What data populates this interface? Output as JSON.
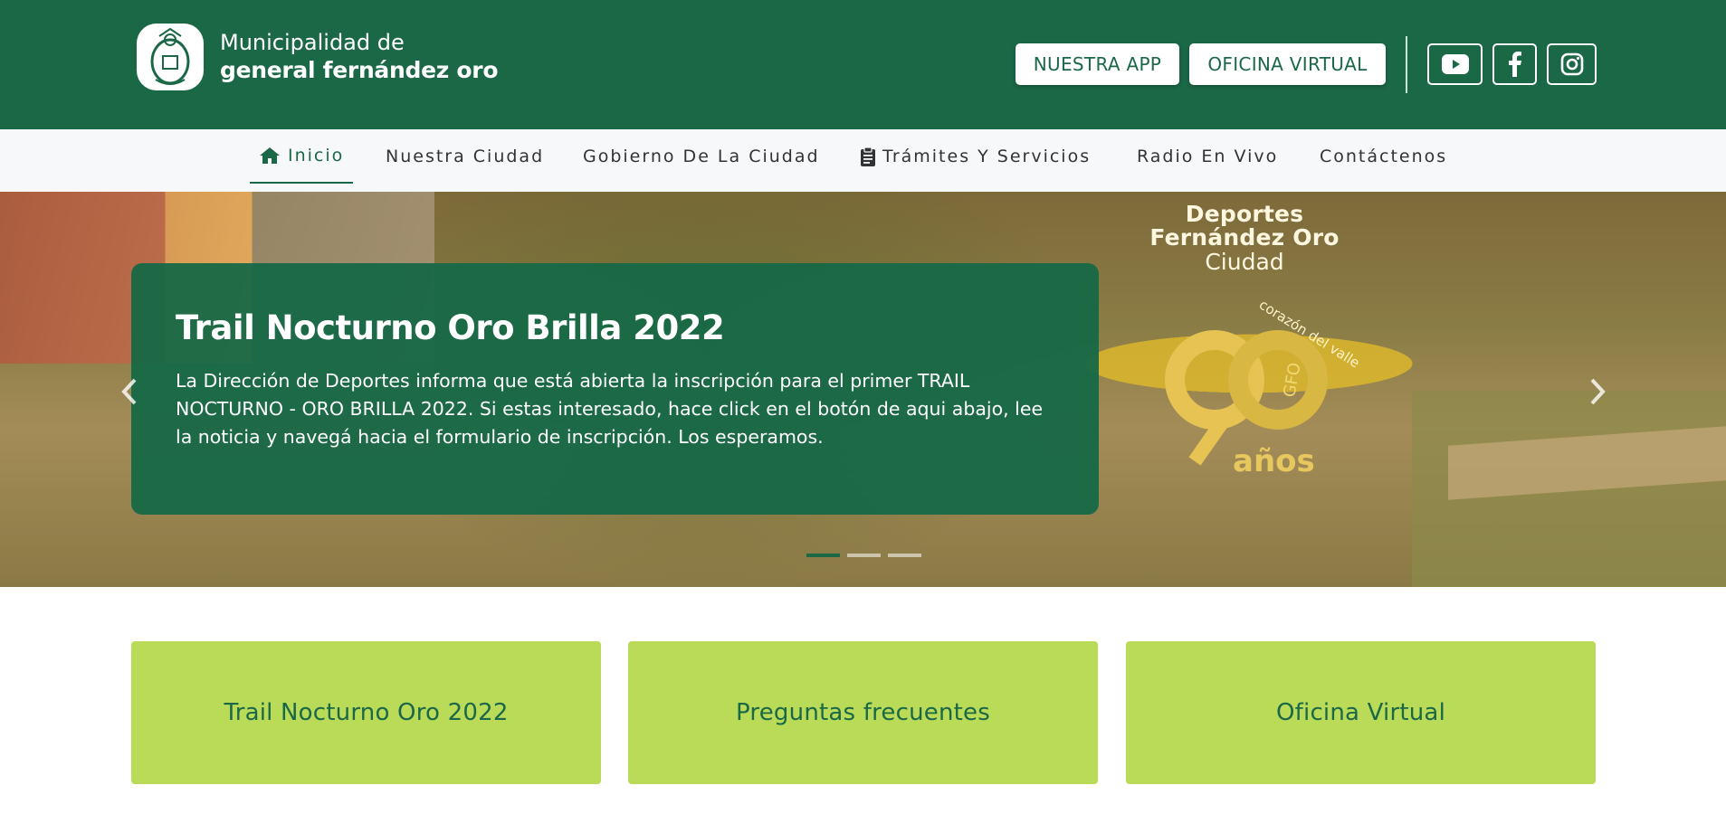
{
  "header": {
    "brand_line1": "Municipalidad de",
    "brand_line2": "general fernández oro",
    "buttons": {
      "app": "NUESTRA APP",
      "oficina": "OFICINA VIRTUAL"
    },
    "social": [
      "youtube-icon",
      "facebook-icon",
      "instagram-icon"
    ],
    "bg_color": "#1b6847"
  },
  "nav": {
    "items": [
      {
        "label": "Inicio",
        "icon": "home-icon",
        "active": true
      },
      {
        "label": "Nuestra Ciudad"
      },
      {
        "label": "Gobierno De La Ciudad"
      },
      {
        "label": "Trámites Y Servicios",
        "icon": "clipboard-icon"
      },
      {
        "label": "Radio En Vivo"
      },
      {
        "label": "Contáctenos"
      }
    ]
  },
  "hero": {
    "caption_title": "Trail Nocturno Oro Brilla 2022",
    "caption_text": "La Dirección de Deportes informa que está abierta la inscripción para el primer TRAIL NOCTURNO - ORO BRILLA 2022. Si estas interesado, hace click en el botón de aqui abajo, lee la noticia y navegá hacia el formulario de inscripción. Los esperamos.",
    "overlay_title_1": "Deportes",
    "overlay_title_2": "Fernández Oro",
    "overlay_title_3": "Ciudad",
    "overlay_anos": "años",
    "overlay_corazon": "corazón del valle",
    "overlay_gfo": "GFO",
    "slide_count": 3,
    "active_slide": 1
  },
  "cards": [
    {
      "label": "Trail Nocturno Oro 2022"
    },
    {
      "label": "Preguntas frecuentes"
    },
    {
      "label": "Oficina Virtual"
    }
  ],
  "colors": {
    "accent": "#1b6847",
    "card": "#b9db58",
    "nav_bg": "#f7f8fa"
  }
}
